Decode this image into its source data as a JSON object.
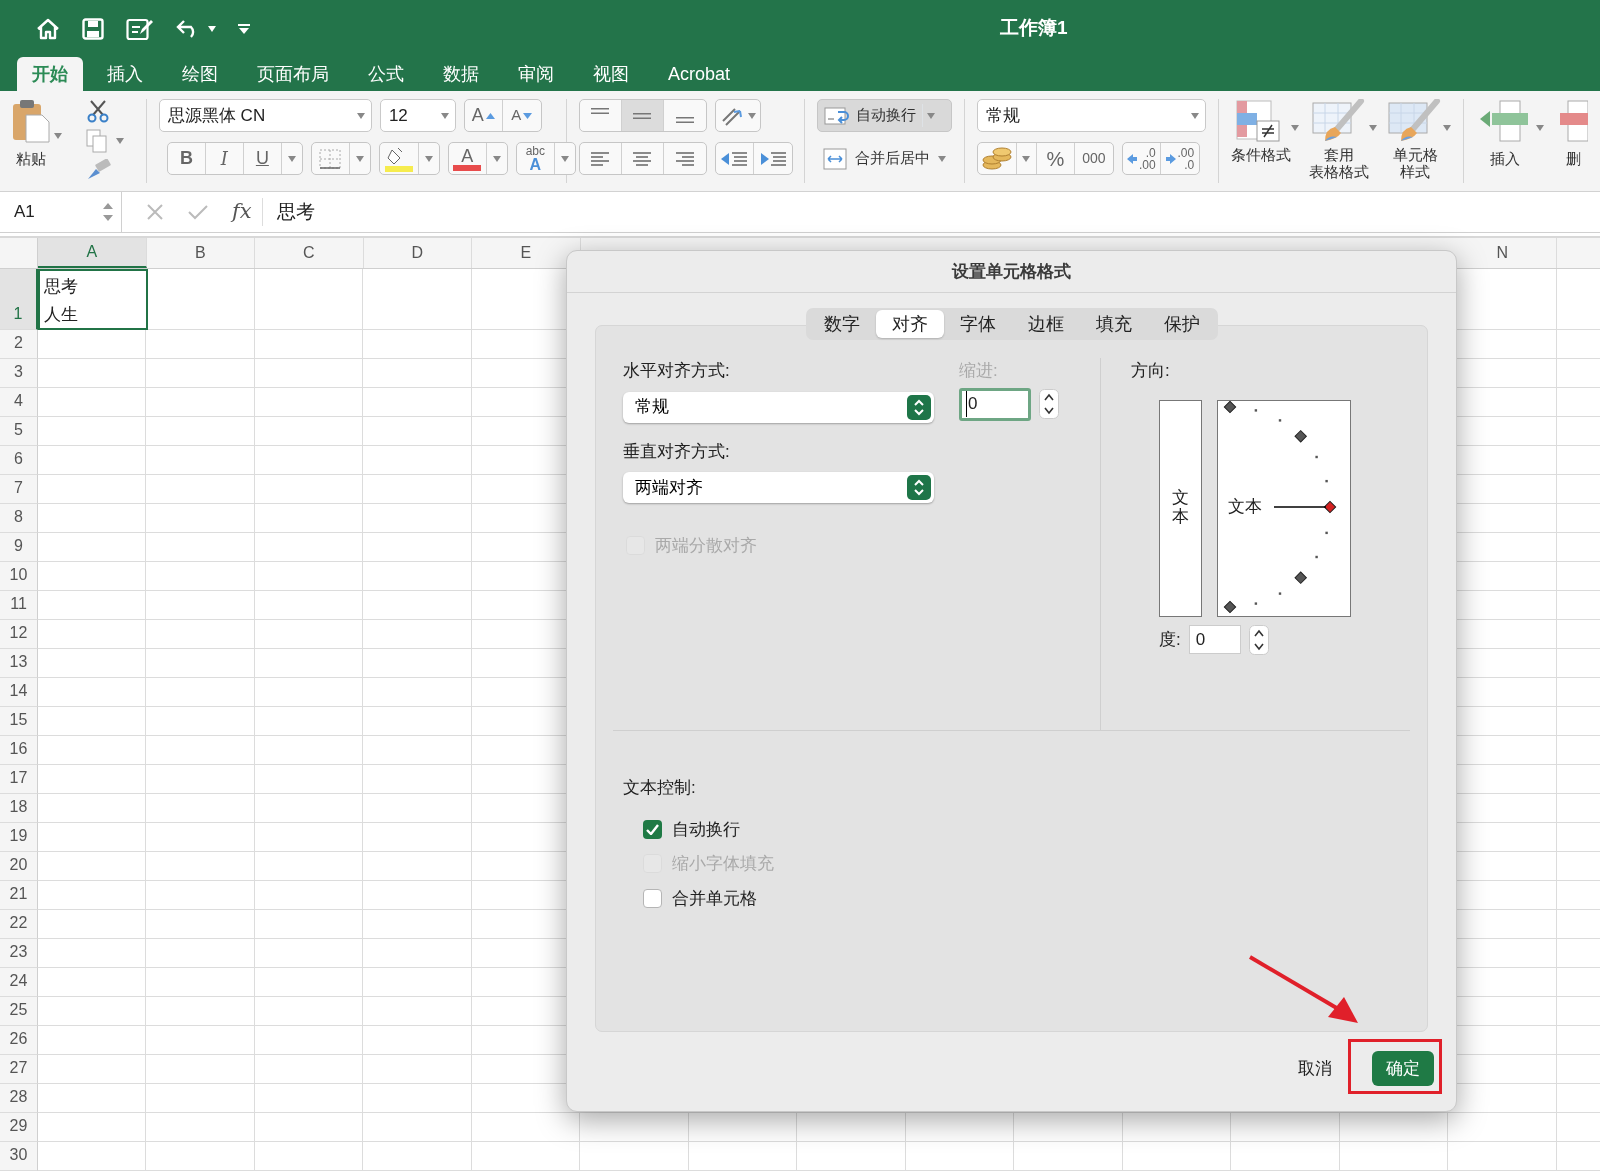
{
  "window": {
    "title": "工作簿1"
  },
  "ribbon_tabs": [
    {
      "label": "开始",
      "selected": true
    },
    {
      "label": "插入",
      "selected": false
    },
    {
      "label": "绘图",
      "selected": false
    },
    {
      "label": "页面布局",
      "selected": false
    },
    {
      "label": "公式",
      "selected": false
    },
    {
      "label": "数据",
      "selected": false
    },
    {
      "label": "审阅",
      "selected": false
    },
    {
      "label": "视图",
      "selected": false
    },
    {
      "label": "Acrobat",
      "selected": false
    }
  ],
  "ribbon": {
    "clipboard": {
      "paste": "粘贴"
    },
    "font": {
      "name": "思源黑体 CN",
      "size": "12",
      "grow": "A",
      "shrink": "A",
      "bold": "B",
      "italic": "I",
      "underline": "U",
      "font_color_label": "A",
      "phonetic_top": "abc",
      "phonetic_bottom": "A"
    },
    "alignment": {
      "vertical": [
        {
          "selected": false
        },
        {
          "selected": true
        },
        {
          "selected": false
        }
      ],
      "wrap_text": {
        "label": "自动换行",
        "pressed": true
      },
      "merge": "合并后居中"
    },
    "number": {
      "format": "常规",
      "percent": "%",
      "thousands": "000",
      "increase_decimal": [
        ".0",
        ".00"
      ],
      "decrease_decimal": [
        ".00",
        ".0"
      ]
    },
    "styles": [
      {
        "kind": "conditional",
        "lines": [
          "条件格式"
        ]
      },
      {
        "kind": "table",
        "lines": [
          "套用",
          "表格格式"
        ]
      },
      {
        "kind": "cell",
        "lines": [
          "单元格",
          "样式"
        ]
      }
    ],
    "cells": [
      {
        "kind": "insert",
        "label": "插入"
      },
      {
        "kind": "delete",
        "label": "删"
      }
    ]
  },
  "formula_bar": {
    "name_box": "A1",
    "function_label": "fx",
    "formula": "思考"
  },
  "sheet": {
    "columns_left": [
      {
        "label": "A",
        "selected": true
      },
      {
        "label": "B",
        "selected": false
      },
      {
        "label": "C",
        "selected": false
      },
      {
        "label": "D",
        "selected": false
      },
      {
        "label": "E",
        "selected": false
      }
    ],
    "columns_right": [
      {
        "label": "N",
        "selected": false
      }
    ],
    "rows": [
      {
        "label": "1",
        "selected": true
      },
      {
        "label": "2",
        "selected": false
      },
      {
        "label": "3",
        "selected": false
      },
      {
        "label": "4",
        "selected": false
      },
      {
        "label": "5",
        "selected": false
      },
      {
        "label": "6",
        "selected": false
      },
      {
        "label": "7",
        "selected": false
      },
      {
        "label": "8",
        "selected": false
      },
      {
        "label": "9",
        "selected": false
      },
      {
        "label": "10",
        "selected": false
      },
      {
        "label": "11",
        "selected": false
      },
      {
        "label": "12",
        "selected": false
      },
      {
        "label": "13",
        "selected": false
      },
      {
        "label": "14",
        "selected": false
      },
      {
        "label": "15",
        "selected": false
      },
      {
        "label": "16",
        "selected": false
      },
      {
        "label": "17",
        "selected": false
      },
      {
        "label": "18",
        "selected": false
      },
      {
        "label": "19",
        "selected": false
      },
      {
        "label": "20",
        "selected": false
      },
      {
        "label": "21",
        "selected": false
      },
      {
        "label": "22",
        "selected": false
      },
      {
        "label": "23",
        "selected": false
      },
      {
        "label": "24",
        "selected": false
      },
      {
        "label": "25",
        "selected": false
      },
      {
        "label": "26",
        "selected": false
      },
      {
        "label": "27",
        "selected": false
      },
      {
        "label": "28",
        "selected": false
      },
      {
        "label": "29",
        "selected": false
      },
      {
        "label": "30",
        "selected": false
      }
    ],
    "active_cell": {
      "lines": [
        "思考",
        "人生"
      ],
      "selected": true
    }
  },
  "dialog": {
    "title": "设置单元格格式",
    "tabs": [
      {
        "label": "数字",
        "selected": false
      },
      {
        "label": "对齐",
        "selected": true
      },
      {
        "label": "字体",
        "selected": false
      },
      {
        "label": "边框",
        "selected": false
      },
      {
        "label": "填充",
        "selected": false
      },
      {
        "label": "保护",
        "selected": false
      }
    ],
    "horizontal": {
      "label": "水平对齐方式:",
      "value": "常规"
    },
    "indent": {
      "label": "缩进:",
      "value": "0",
      "disabled": true,
      "focused": true
    },
    "vertical": {
      "label": "垂直对齐方式:",
      "value": "两端对齐"
    },
    "justify_distributed": {
      "label": "两端分散对齐",
      "checked": false,
      "disabled": true
    },
    "orientation": {
      "label": "方向:",
      "vertical_text": "文本",
      "dial_text": "文本",
      "degrees_label": "度:",
      "degrees": "0"
    },
    "text_control": {
      "label": "文本控制:",
      "options": [
        {
          "label": "自动换行",
          "checked": true,
          "disabled": false
        },
        {
          "label": "缩小字体填充",
          "checked": false,
          "disabled": true
        },
        {
          "label": "合并单元格",
          "checked": false,
          "disabled": false
        }
      ]
    },
    "buttons": [
      {
        "label": "取消",
        "default": false
      },
      {
        "label": "确定",
        "default": true
      }
    ]
  }
}
